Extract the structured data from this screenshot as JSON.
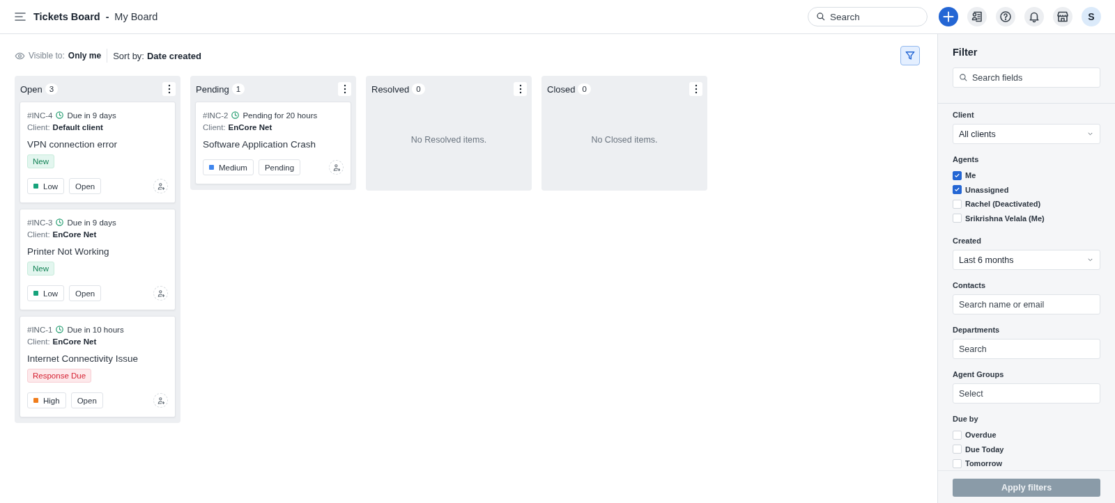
{
  "header": {
    "title": "Tickets Board",
    "separator": "-",
    "subtitle": "My Board",
    "search": {
      "placeholder": "Search"
    },
    "avatar": "S"
  },
  "toolbar": {
    "visibility_label": "Visible to:",
    "visibility_value": "Only me",
    "sort_label": "Sort by:",
    "sort_value": "Date created",
    "filter_active": true
  },
  "columns": [
    {
      "title": "Open",
      "count": "3",
      "cards": [
        {
          "id": "#INC-4",
          "timing": "Due in 9 days",
          "client_label": "Client:",
          "client": "Default client",
          "subject": "VPN connection error",
          "tag": {
            "text": "New",
            "kind": "new"
          },
          "priority": {
            "text": "Low",
            "color": "#16a37b"
          },
          "status": "Open"
        },
        {
          "id": "#INC-3",
          "timing": "Due in 9 days",
          "client_label": "Client:",
          "client": "EnCore Net",
          "subject": "Printer Not Working",
          "tag": {
            "text": "New",
            "kind": "new"
          },
          "priority": {
            "text": "Low",
            "color": "#16a37b"
          },
          "status": "Open"
        },
        {
          "id": "#INC-1",
          "timing": "Due in 10 hours",
          "client_label": "Client:",
          "client": "EnCore Net",
          "subject": "Internet Connectivity Issue",
          "tag": {
            "text": "Response Due",
            "kind": "due"
          },
          "priority": {
            "text": "High",
            "color": "#f07d1c"
          },
          "status": "Open"
        }
      ]
    },
    {
      "title": "Pending",
      "count": "1",
      "cards": [
        {
          "id": "#INC-2",
          "timing": "Pending for 20 hours",
          "client_label": "Client:",
          "client": "EnCore Net",
          "subject": "Software Application Crash",
          "priority": {
            "text": "Medium",
            "color": "#3f86ee"
          },
          "status": "Pending"
        }
      ]
    },
    {
      "title": "Resolved",
      "count": "0",
      "empty_text": "No Resolved items."
    },
    {
      "title": "Closed",
      "count": "0",
      "empty_text": "No Closed items."
    }
  ],
  "filter_panel": {
    "title": "Filter",
    "search": {
      "placeholder": "Search fields"
    },
    "sections": [
      {
        "label": "Client",
        "kind": "select",
        "value": "All clients"
      },
      {
        "label": "Agents",
        "kind": "checklist",
        "options": [
          {
            "label": "Me",
            "checked": true
          },
          {
            "label": "Unassigned",
            "checked": true
          },
          {
            "label": "Rachel (Deactivated)",
            "checked": false
          },
          {
            "label": "Srikrishna Velala (Me)",
            "checked": false
          }
        ]
      },
      {
        "label": "Created",
        "kind": "select",
        "value": "Last 6 months"
      },
      {
        "label": "Contacts",
        "kind": "input",
        "placeholder": "Search name or email"
      },
      {
        "label": "Departments",
        "kind": "input",
        "placeholder": "Search"
      },
      {
        "label": "Agent Groups",
        "kind": "input",
        "placeholder": "Select"
      },
      {
        "label": "Due by",
        "kind": "checklist",
        "options": [
          {
            "label": "Overdue",
            "checked": false
          },
          {
            "label": "Due Today",
            "checked": false
          },
          {
            "label": "Tomorrow",
            "checked": false
          }
        ]
      }
    ],
    "apply_button": {
      "label": "Apply filters",
      "disabled": true
    }
  }
}
